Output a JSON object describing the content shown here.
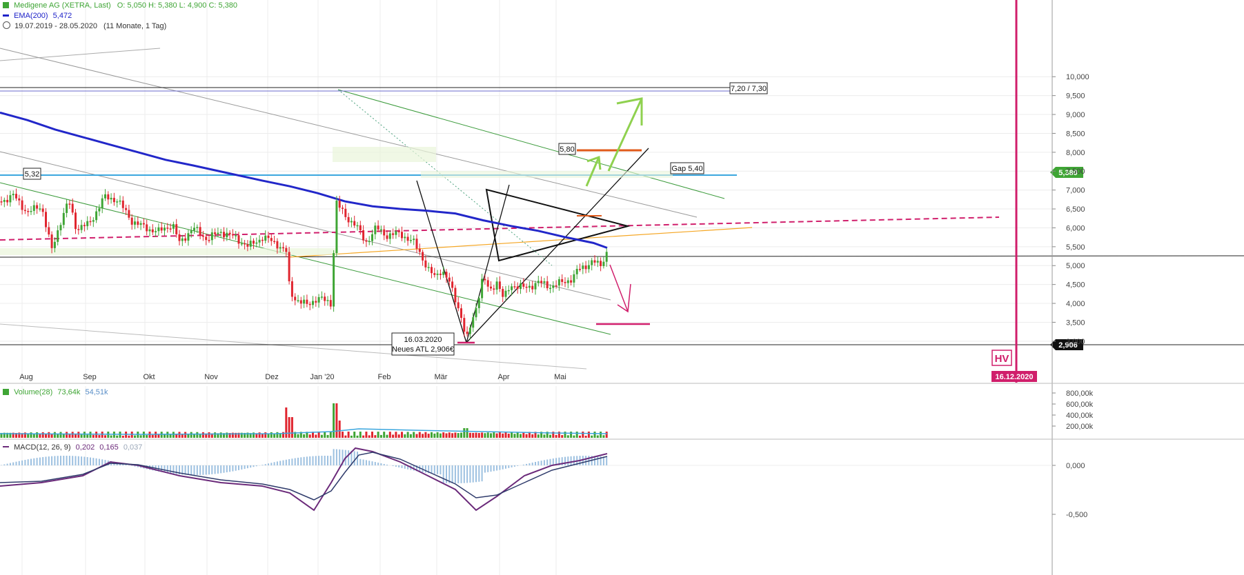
{
  "header": {
    "title": "Medigene AG (XETRA, Last)",
    "ohlc": "O: 5,050  H: 5,380  L: 4,900  C: 5,380",
    "ema_label": "EMA(200)",
    "ema_value": "5,472",
    "range": "19.07.2019 - 28.05.2020",
    "range_detail": "(11 Monate, 1 Tag)"
  },
  "volume_legend": {
    "label": "Volume(28)",
    "v1": "73,64k",
    "v2": "54,51k"
  },
  "macd_legend": {
    "label": "MACD(12, 26, 9)",
    "v1": "0,202",
    "v2": "0,165",
    "v3": "0,037"
  },
  "colors": {
    "up": "#3fa535",
    "down": "#e0252f",
    "ema": "#2227c9",
    "hline_blue": "#3aa6de",
    "magenta": "#d01e6b",
    "orange": "#f5a623",
    "lightgreen": "#8fd14f",
    "channel_green": "#3a9a3a"
  },
  "chart_data": {
    "type": "candlestick",
    "title": "Medigene AG (XETRA, Last)",
    "price_ticks": [
      "10,000",
      "9,500",
      "9,000",
      "8,500",
      "8,000",
      "7,500",
      "7,000",
      "6,500",
      "6,000",
      "5,500",
      "5,000",
      "4,500",
      "4,000",
      "3,500",
      "3,000"
    ],
    "price_min": 2.4,
    "price_max": 10.1,
    "months": [
      "Aug",
      "Sep",
      "Okt",
      "Nov",
      "Dez",
      "Jan '20",
      "Feb",
      "Mär",
      "Apr",
      "Mai"
    ],
    "current_price": "5,380",
    "atl_price": "2,906",
    "hv_date": "16.12.2020",
    "hv_label": "HV",
    "annotations": {
      "level_532": "5,32",
      "level_720": "7,20 / 7,30",
      "level_580": "5,80",
      "gap": "Gap 5,40",
      "atl_date": "16.03.2020",
      "atl_text": "Neues ATL 2,906€"
    },
    "volume_ticks": [
      "800,00k",
      "600,00k",
      "400,00k",
      "200,00k"
    ],
    "macd_ticks": [
      "0,000",
      "-0,500"
    ],
    "ema_points": [
      [
        0,
        9.05
      ],
      [
        40,
        8.85
      ],
      [
        80,
        8.6
      ],
      [
        120,
        8.4
      ],
      [
        160,
        8.2
      ],
      [
        200,
        8.0
      ],
      [
        240,
        7.8
      ],
      [
        280,
        7.65
      ],
      [
        330,
        7.45
      ],
      [
        380,
        7.25
      ],
      [
        420,
        7.1
      ],
      [
        460,
        6.92
      ],
      [
        500,
        6.7
      ],
      [
        540,
        6.57
      ],
      [
        580,
        6.5
      ],
      [
        620,
        6.45
      ],
      [
        660,
        6.38
      ],
      [
        700,
        6.2
      ],
      [
        740,
        6.05
      ],
      [
        780,
        5.92
      ],
      [
        820,
        5.75
      ],
      [
        860,
        5.6
      ],
      [
        880,
        5.47
      ]
    ],
    "price_path": [
      [
        0,
        6.7
      ],
      [
        20,
        6.85
      ],
      [
        40,
        6.4
      ],
      [
        60,
        6.6
      ],
      [
        75,
        5.4
      ],
      [
        90,
        6.3
      ],
      [
        100,
        6.7
      ],
      [
        110,
        6.0
      ],
      [
        130,
        6.1
      ],
      [
        150,
        6.8
      ],
      [
        170,
        6.75
      ],
      [
        190,
        6.2
      ],
      [
        210,
        6.0
      ],
      [
        230,
        5.9
      ],
      [
        250,
        6.1
      ],
      [
        260,
        5.6
      ],
      [
        280,
        6.0
      ],
      [
        300,
        5.7
      ],
      [
        320,
        5.9
      ],
      [
        340,
        5.75
      ],
      [
        360,
        5.5
      ],
      [
        380,
        5.75
      ],
      [
        400,
        5.6
      ],
      [
        415,
        5.35
      ],
      [
        420,
        4.3
      ],
      [
        430,
        4.1
      ],
      [
        445,
        3.95
      ],
      [
        460,
        4.15
      ],
      [
        480,
        4.0
      ],
      [
        487,
        6.7
      ],
      [
        500,
        6.3
      ],
      [
        515,
        6.1
      ],
      [
        530,
        5.6
      ],
      [
        545,
        6.0
      ],
      [
        560,
        5.8
      ],
      [
        580,
        5.85
      ],
      [
        600,
        5.6
      ],
      [
        610,
        5.3
      ],
      [
        620,
        4.9
      ],
      [
        630,
        4.7
      ],
      [
        640,
        4.9
      ],
      [
        650,
        4.6
      ],
      [
        660,
        4.1
      ],
      [
        668,
        3.7
      ],
      [
        676,
        3.0
      ],
      [
        682,
        3.4
      ],
      [
        690,
        3.9
      ],
      [
        700,
        4.7
      ],
      [
        710,
        4.3
      ],
      [
        720,
        4.6
      ],
      [
        730,
        4.1
      ],
      [
        740,
        4.5
      ],
      [
        760,
        4.4
      ],
      [
        780,
        4.55
      ],
      [
        800,
        4.45
      ],
      [
        820,
        4.6
      ],
      [
        830,
        4.65
      ],
      [
        838,
        4.9
      ],
      [
        848,
        5.0
      ],
      [
        860,
        5.1
      ],
      [
        870,
        5.0
      ],
      [
        880,
        5.38
      ]
    ]
  }
}
